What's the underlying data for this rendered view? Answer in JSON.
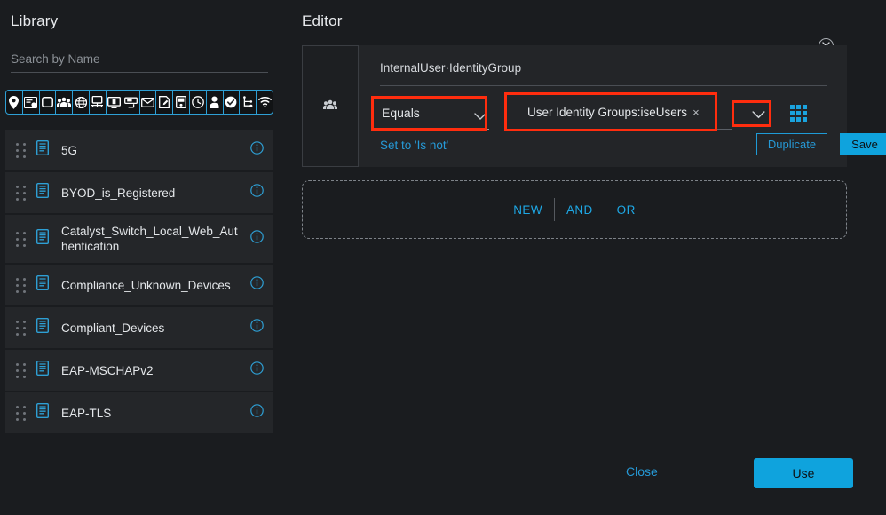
{
  "library": {
    "title": "Library",
    "search": {
      "placeholder": "Search by Name",
      "value": ""
    },
    "filter_icons": [
      "location-pin-icon",
      "network-device-icon",
      "square-icon",
      "users-group-icon",
      "globe-icon",
      "desktop-network-icon",
      "monitor-icon",
      "printer-icon",
      "envelope-icon",
      "document-edit-icon",
      "server-icon",
      "clock-icon",
      "person-icon",
      "check-circle-icon",
      "branch-icon",
      "wifi-icon"
    ],
    "items": [
      {
        "label": "5G",
        "icon": "condition-doc-icon",
        "info": "info-icon",
        "handle": "drag-handle-icon"
      },
      {
        "label": "BYOD_is_Registered",
        "icon": "condition-doc-icon",
        "info": "info-icon",
        "handle": "drag-handle-icon"
      },
      {
        "label": "Catalyst_Switch_Local_Web_Authentication",
        "icon": "condition-doc-icon",
        "info": "info-icon",
        "handle": "drag-handle-icon"
      },
      {
        "label": "Compliance_Unknown_Devices",
        "icon": "condition-doc-icon",
        "info": "info-icon",
        "handle": "drag-handle-icon"
      },
      {
        "label": "Compliant_Devices",
        "icon": "condition-doc-icon",
        "info": "info-icon",
        "handle": "drag-handle-icon"
      },
      {
        "label": "EAP-MSCHAPv2",
        "icon": "condition-doc-icon",
        "info": "info-icon",
        "handle": "drag-handle-icon"
      },
      {
        "label": "EAP-TLS",
        "icon": "condition-doc-icon",
        "info": "info-icon",
        "handle": "drag-handle-icon"
      }
    ]
  },
  "editor": {
    "title": "Editor",
    "close_icon": "close-circle-icon",
    "condition": {
      "aside_icon": "users-group-icon",
      "attribute": "InternalUser·IdentityGroup",
      "operator": {
        "value": "Equals",
        "chevron": "chevron-down-icon"
      },
      "value_field": {
        "token": "User Identity Groups:iseUsers",
        "token_remove": "×",
        "chevron": "chevron-down-icon",
        "grid_icon": "grid-3x3-icon"
      },
      "set_is_not_label": "Set to 'Is not'",
      "duplicate_label": "Duplicate",
      "save_label": "Save"
    },
    "dropzone": {
      "new_label": "NEW",
      "and_label": "AND",
      "or_label": "OR"
    },
    "footer": {
      "close_label": "Close",
      "use_label": "Use"
    }
  },
  "colors": {
    "accent_blue": "#0fa3dd",
    "link_blue": "#2699d6",
    "annotation_red": "#ff2d0e",
    "panel_bg": "#1a1c1f",
    "row_bg": "#242629",
    "card_bg": "#232528"
  }
}
